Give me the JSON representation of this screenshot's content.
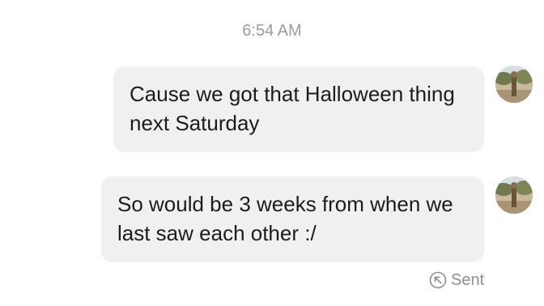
{
  "conversation": {
    "timestamp": "6:54 AM",
    "messages": [
      {
        "text_line1": "Cause we got that Halloween thing",
        "text_line2": "next Saturday"
      },
      {
        "text_line1": "So would be 3 weeks from when we",
        "text_line2": "last saw each other :/"
      }
    ],
    "status": {
      "icon": "sent-arrow-circle-icon",
      "label": "Sent"
    }
  },
  "colors": {
    "bubble_background": "#f0f0f2",
    "message_text": "#1c1c1e",
    "meta_text": "#8e8e93"
  }
}
